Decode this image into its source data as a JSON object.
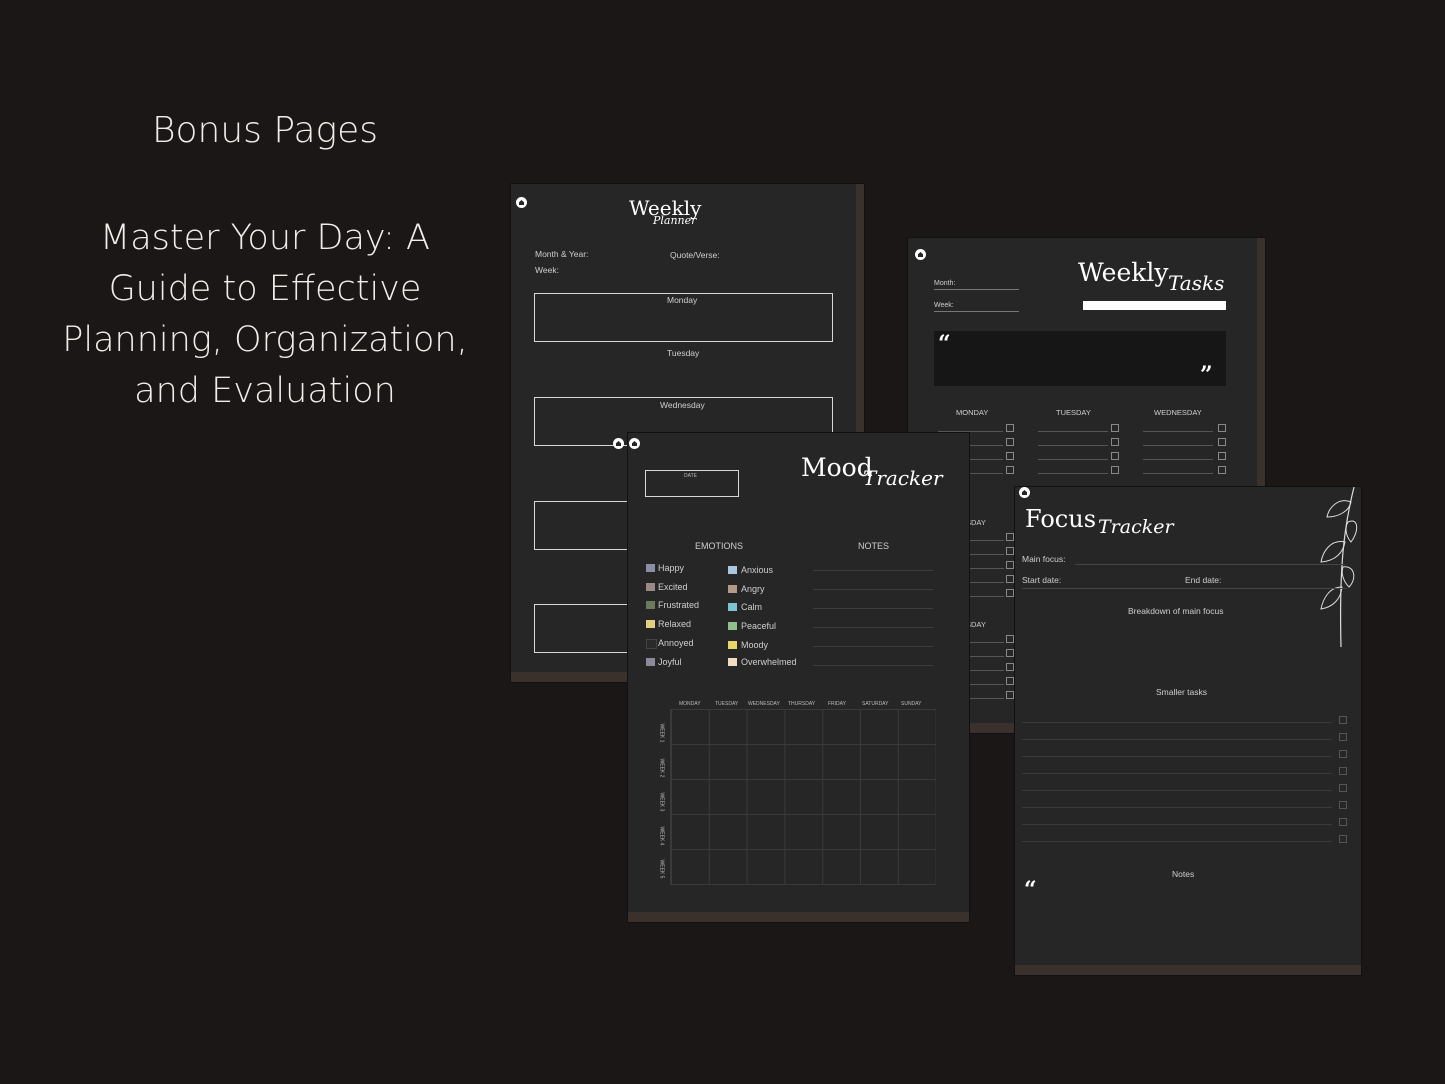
{
  "hero": {
    "title": "Bonus Pages",
    "subtitle_lines": [
      "Master Your Day: A",
      "Guide to Effective",
      "Planning, Organization,",
      "and Evaluation"
    ]
  },
  "weekly_planner": {
    "title_main": "Weekly",
    "title_script": "Planner",
    "month_year": "Month & Year:",
    "week": "Week:",
    "quote": "Quote/Verse:",
    "days": [
      "Monday",
      "Tuesday",
      "Wednesday"
    ]
  },
  "weekly_tasks": {
    "title_main": "Weekly",
    "title_script": "Tasks",
    "month": "Month:",
    "week": "Week:",
    "days": [
      "MONDAY",
      "TUESDAY",
      "WEDNESDAY"
    ],
    "row2_days": [
      "SDAY",
      "SDAY"
    ]
  },
  "mood_tracker": {
    "title_main": "Mood",
    "title_script": "Tracker",
    "date": "DATE",
    "emotions_label": "EMOTIONS",
    "notes_label": "NOTES",
    "emotions": [
      {
        "label": "Happy",
        "color": "#8a8fa6"
      },
      {
        "label": "Excited",
        "color": "#9a8a86"
      },
      {
        "label": "Frustrated",
        "color": "#6b7a5a"
      },
      {
        "label": "Relaxed",
        "color": "#e0cf7c"
      },
      {
        "label": "Annoyed",
        "color": "#2a2a2a"
      },
      {
        "label": "Joyful",
        "color": "#8a8a9a"
      },
      {
        "label": "Anxious",
        "color": "#a9c7e3"
      },
      {
        "label": "Angry",
        "color": "#b39a88"
      },
      {
        "label": "Calm",
        "color": "#7bc3cf"
      },
      {
        "label": "Peaceful",
        "color": "#8fbf8a"
      },
      {
        "label": "Moody",
        "color": "#e8d86a"
      },
      {
        "label": "Overwhelmed",
        "color": "#f0dcc0"
      }
    ],
    "weekdays": [
      "MONDAY",
      "TUESDAY",
      "WEDNESDAY",
      "THURSDAY",
      "FRIDAY",
      "SATURDAY",
      "SUNDAY"
    ],
    "weeks": [
      "WEEK 1",
      "WEEK 2",
      "WEEK 3",
      "WEEK 4",
      "WEEK 5"
    ]
  },
  "focus_tracker": {
    "title_main": "Focus",
    "title_script": "Tracker",
    "main_focus": "Main focus:",
    "start_date": "Start date:",
    "end_date": "End date:",
    "breakdown": "Breakdown of main focus",
    "smaller_tasks": "Smaller tasks",
    "notes": "Notes"
  }
}
